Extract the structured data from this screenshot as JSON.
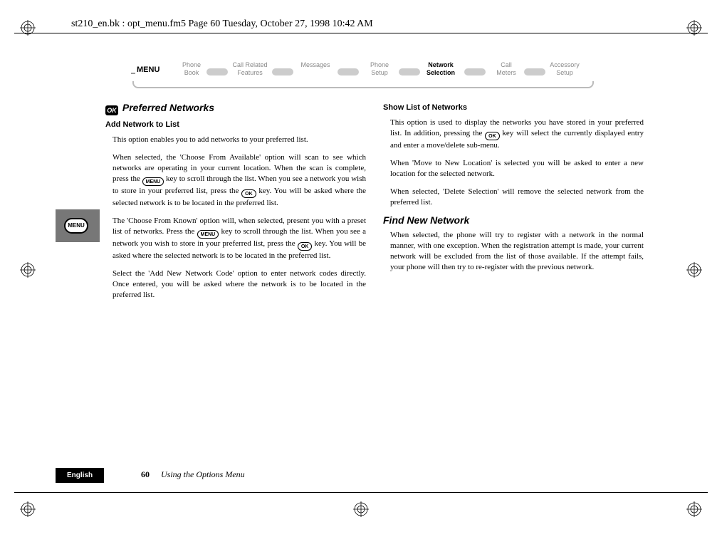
{
  "header_path": "st210_en.bk : opt_menu.fm5  Page 60  Tuesday, October 27, 1998  10:42 AM",
  "menu": {
    "label": "MENU",
    "items": [
      {
        "line1": "Phone",
        "line2": "Book"
      },
      {
        "line1": "Call Related",
        "line2": "Features"
      },
      {
        "line1": "Messages",
        "line2": ""
      },
      {
        "line1": "Phone",
        "line2": "Setup"
      },
      {
        "line1": "Network",
        "line2": "Selection"
      },
      {
        "line1": "Call",
        "line2": "Meters"
      },
      {
        "line1": "Accessory",
        "line2": "Setup"
      }
    ],
    "active_index": 4
  },
  "side_icon_label": "MENU",
  "keys": {
    "ok": "OK",
    "menu": "MENU"
  },
  "left": {
    "h2_badge": "OK",
    "h2": "Preferred Networks",
    "h3a": "Add Network to List",
    "p1": "This option enables you to add networks to your preferred list.",
    "p2a": "When selected, the 'Choose From Available' option will scan to see which networks are operating in your current location. When the scan is complete, press the ",
    "p2b": " key to scroll through the list. When you see a network you wish to store in your preferred list, press the ",
    "p2c": " key. You will be asked where the selected network is to be located in the preferred list.",
    "p3a": "The 'Choose From Known' option will, when selected, present you with a preset list of networks. Press the ",
    "p3b": " key to scroll through the list. When you see a network you wish to store in your preferred list, press the ",
    "p3c": " key. You will be asked where the selected network is to be located in the preferred list.",
    "p4": "Select the 'Add New Network Code' option to enter network codes directly. Once entered, you will be asked where the network is to be located in the preferred list."
  },
  "right": {
    "h3a": "Show List of Networks",
    "p1a": "This option is used to display the networks you have stored in your preferred list. In addition, pressing the ",
    "p1b": " key will select the currently displayed entry and enter a move/delete sub-menu.",
    "p2": "When 'Move to New Location' is selected you will be asked to enter a new location for the selected network.",
    "p3": "When selected, 'Delete Selection' will remove the selected network from the preferred list.",
    "h2": "Find New Network",
    "p4": "When selected, the phone will try to register with a network in the normal manner, with one exception. When the registration attempt is made, your current network will be excluded from the list of those available. If the attempt fails, your phone will then try to re-register with the previous network."
  },
  "footer": {
    "lang": "English",
    "page": "60",
    "chapter": "Using the Options Menu"
  }
}
